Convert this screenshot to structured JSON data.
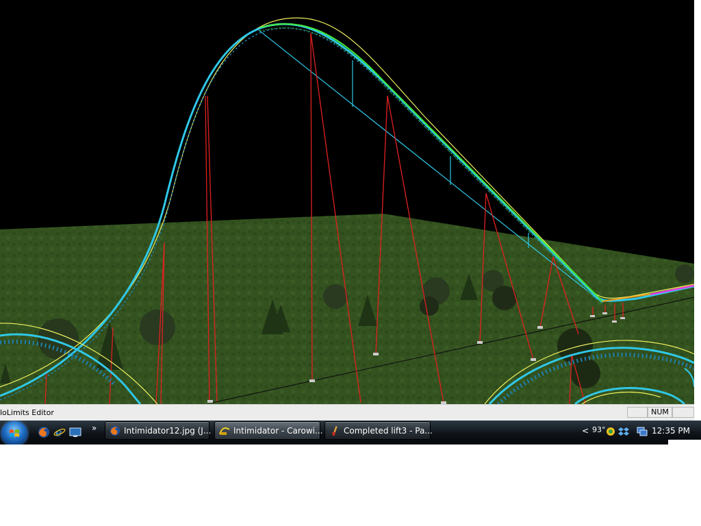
{
  "viewport": {
    "scene": "NoLimits coaster editor 3D view"
  },
  "statusbar": {
    "text": "loLimits Editor",
    "cells": [
      "",
      "NUM",
      ""
    ]
  },
  "taskbar": {
    "start_icon": "windows-flag-icon",
    "quicklaunch": [
      "firefox-icon",
      "internet-explorer-icon",
      "show-desktop-icon"
    ],
    "quicklaunch_more": "»",
    "buttons": [
      {
        "label": "Intimidator12.jpg (J...",
        "icon": "firefox-icon"
      },
      {
        "label": "Intimidator - Carowi...",
        "icon": "nolimits-icon"
      },
      {
        "label": "Completed lift3 - Pa...",
        "icon": "paint-icon"
      }
    ],
    "tray": {
      "chevron": "<",
      "temperature": "93°",
      "icons": [
        "weather-icon",
        "dropbox-icon",
        "network-icon"
      ],
      "clock": "12:35 PM"
    }
  }
}
